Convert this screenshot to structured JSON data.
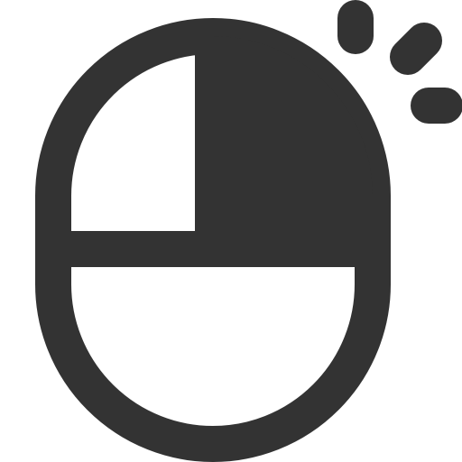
{
  "icon": {
    "name": "mouse-right-click-icon",
    "color": "#333333",
    "background": "#ffffff"
  }
}
